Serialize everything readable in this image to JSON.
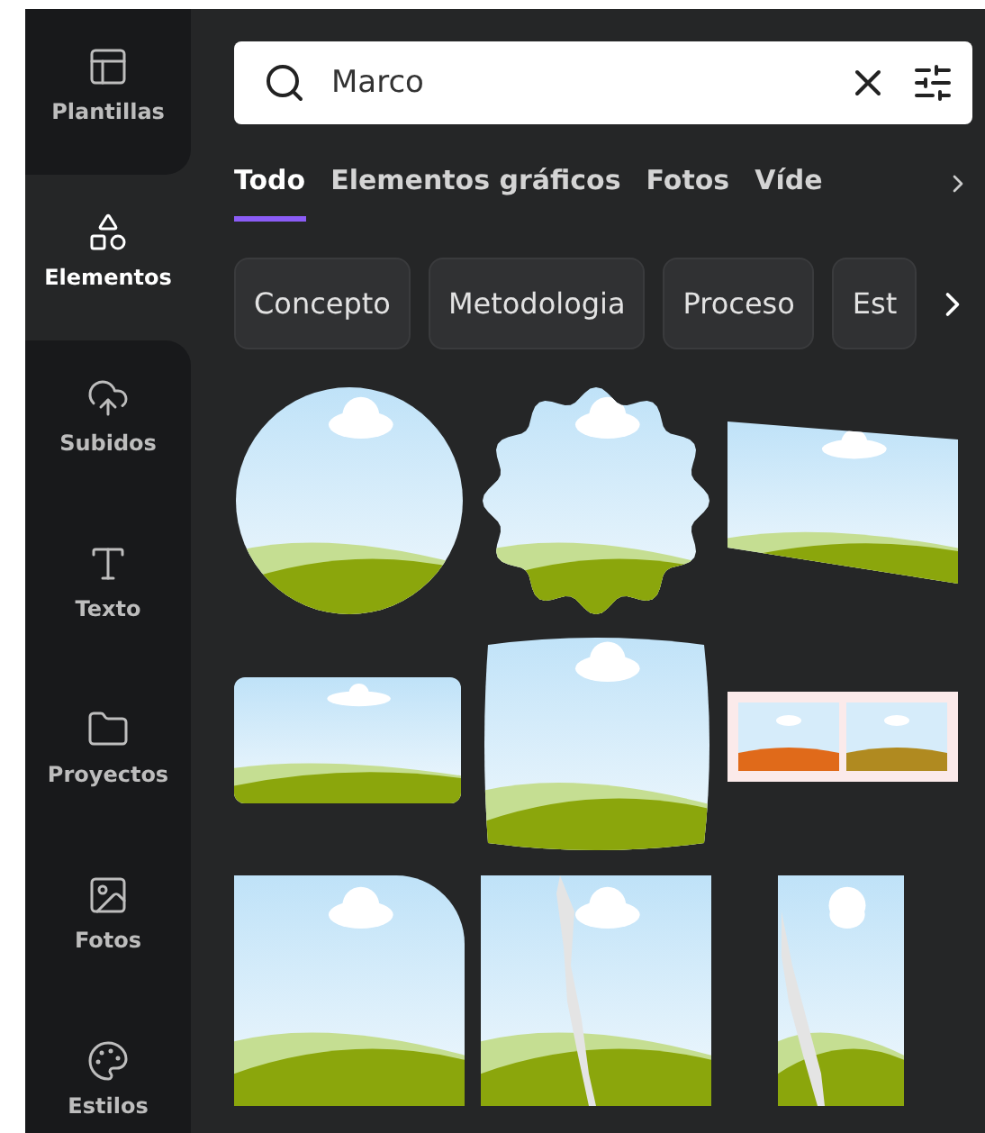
{
  "sidebar": {
    "items": [
      {
        "label": "Plantillas",
        "selected": false
      },
      {
        "label": "Elementos",
        "selected": true
      },
      {
        "label": "Subidos",
        "selected": false
      },
      {
        "label": "Texto",
        "selected": false
      },
      {
        "label": "Proyectos",
        "selected": false
      },
      {
        "label": "Fotos",
        "selected": false
      },
      {
        "label": "Estilos",
        "selected": false
      }
    ]
  },
  "search": {
    "value": "Marco"
  },
  "tabs": [
    {
      "label": "Todo",
      "selected": true
    },
    {
      "label": "Elementos gráficos",
      "selected": false
    },
    {
      "label": "Fotos",
      "selected": false
    },
    {
      "label": "Víde",
      "selected": false
    }
  ],
  "chips": [
    "Concepto",
    "Metodologia",
    "Proceso",
    "Est"
  ],
  "frames": [
    {
      "kind": "circle"
    },
    {
      "kind": "scalloped"
    },
    {
      "kind": "skewed"
    },
    {
      "kind": "rounded"
    },
    {
      "kind": "wavy"
    },
    {
      "kind": "filmstrip"
    },
    {
      "kind": "cutcorner"
    },
    {
      "kind": "torn"
    },
    {
      "kind": "tornnarrow"
    }
  ]
}
